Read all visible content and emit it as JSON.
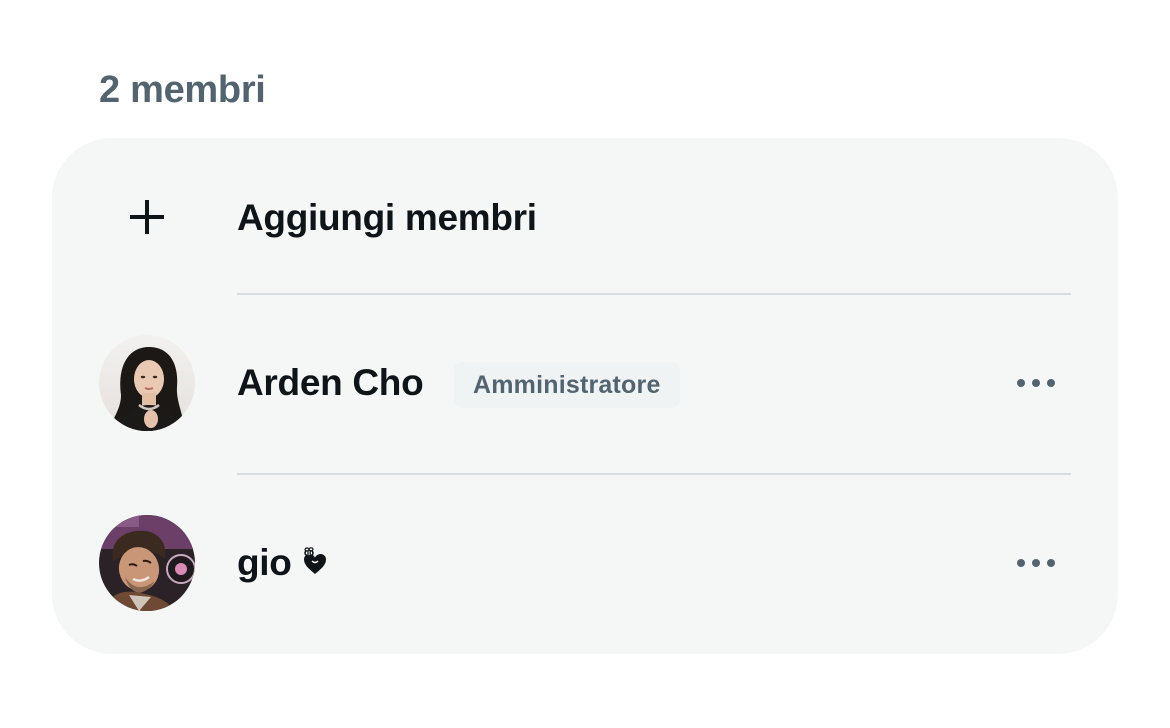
{
  "header": {
    "member_count_label": "2 membri"
  },
  "add_members": {
    "label": "Aggiungi membri",
    "icon": "plus-icon"
  },
  "members": [
    {
      "name": "Arden Cho",
      "role_badge": "Amministratore",
      "avatar": "avatar-photo",
      "more_icon": "more-icon"
    },
    {
      "name": "gio",
      "name_emoji_icon": "heart-with-bee-icon",
      "avatar": "avatar-photo",
      "more_icon": "more-icon"
    }
  ],
  "colors": {
    "card_background": "#f5f7f7",
    "primary_text": "#0f1419",
    "secondary_text": "#536471",
    "badge_background": "#eff3f4",
    "divider": "#d7dce0"
  }
}
